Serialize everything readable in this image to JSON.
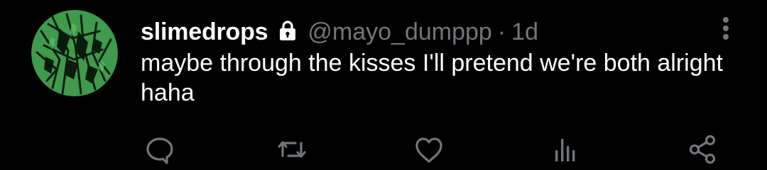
{
  "tweet": {
    "display_name": "slimedrops",
    "handle": "@mayo_dumppp",
    "separator": "·",
    "time": "1d",
    "text": "maybe through the kisses I'll pretend we're both alright haha",
    "protected_icon": "lock-icon",
    "avatar_icon": "green-abstract-avatar"
  },
  "actions": [
    {
      "name": "reply",
      "icon": "comment-bubble-icon"
    },
    {
      "name": "retweet",
      "icon": "retweet-arrows-icon"
    },
    {
      "name": "like",
      "icon": "heart-icon"
    },
    {
      "name": "analytics",
      "icon": "bar-chart-icon"
    },
    {
      "name": "share",
      "icon": "share-nodes-icon"
    }
  ],
  "colors": {
    "background": "#000000",
    "text_primary": "#ffffff",
    "text_secondary": "#71767b",
    "icon": "#71767b",
    "avatar_green": "#3f9a4c"
  }
}
